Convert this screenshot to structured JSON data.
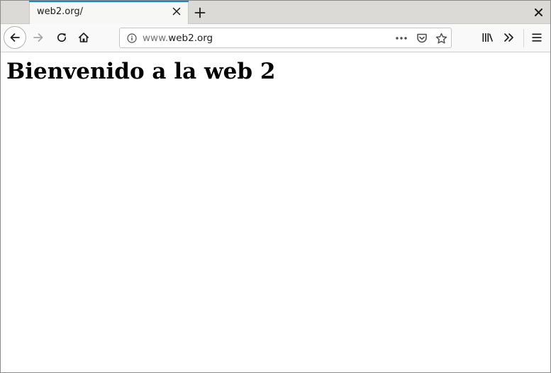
{
  "tab": {
    "title": "web2.org/"
  },
  "address_bar": {
    "url_prefix": "www.",
    "url_domain": "web2.org"
  },
  "page": {
    "heading": "Bienvenido a la web 2"
  },
  "icons": {
    "back": "back-arrow-icon",
    "forward": "forward-arrow-icon",
    "reload": "reload-icon",
    "home": "home-icon",
    "info": "info-icon",
    "page_actions": "more-horizontal-icon",
    "pocket": "pocket-icon",
    "bookmark": "star-icon",
    "library": "library-icon",
    "overflow": "chevron-double-right-icon",
    "menu": "hamburger-menu-icon",
    "new_tab": "plus-icon",
    "close_tab": "close-icon",
    "close_window": "close-icon"
  },
  "colors": {
    "tab_accent": "#0a84ff",
    "tabstrip_bg": "#dcdad6",
    "toolbar_bg": "#f9f9fa"
  }
}
